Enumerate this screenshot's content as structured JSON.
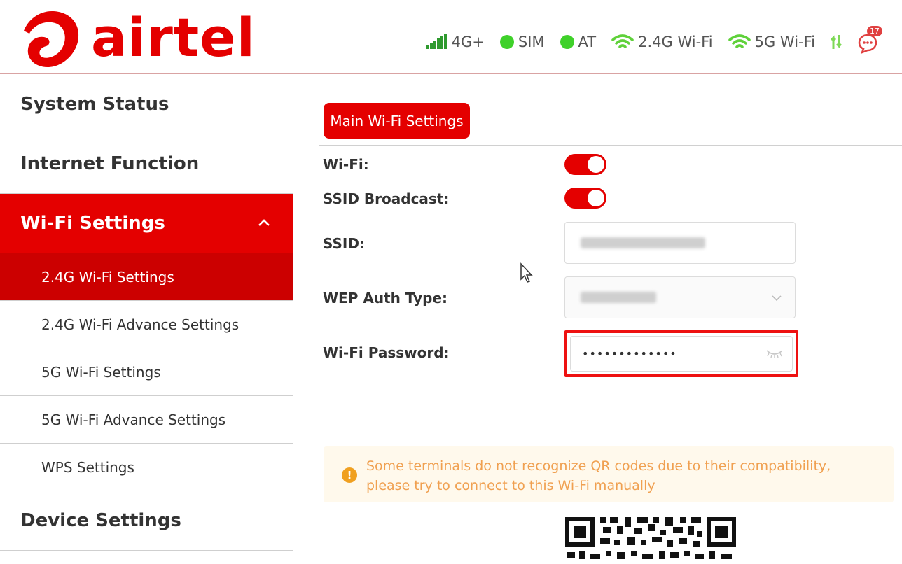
{
  "brand": {
    "name": "airtel",
    "color": "#e40000"
  },
  "status_bar": {
    "network": "4G+",
    "sim": "SIM",
    "at": "AT",
    "wifi_24": "2.4G Wi-Fi",
    "wifi_5": "5G Wi-Fi",
    "messages_count": "17",
    "status_color": "#3fd12a"
  },
  "sidebar": {
    "system_status": "System Status",
    "internet_function": "Internet Function",
    "wifi_settings": "Wi-Fi Settings",
    "sub_items": [
      "2.4G Wi-Fi Settings",
      "2.4G Wi-Fi Advance Settings",
      "5G Wi-Fi Settings",
      "5G Wi-Fi Advance Settings",
      "WPS Settings"
    ],
    "device_settings": "Device Settings"
  },
  "main": {
    "tab_label": "Main Wi-Fi Settings",
    "wifi_label": "Wi-Fi:",
    "wifi_enabled": true,
    "ssid_broadcast_label": "SSID Broadcast:",
    "ssid_broadcast_enabled": true,
    "ssid_label": "SSID:",
    "wep_auth_label": "WEP Auth Type:",
    "password_label": "Wi-Fi Password:",
    "password_value": "•••••••••••••",
    "notice": "Some terminals do not recognize QR codes due to their compatibility, please try to connect to this Wi-Fi manually"
  }
}
